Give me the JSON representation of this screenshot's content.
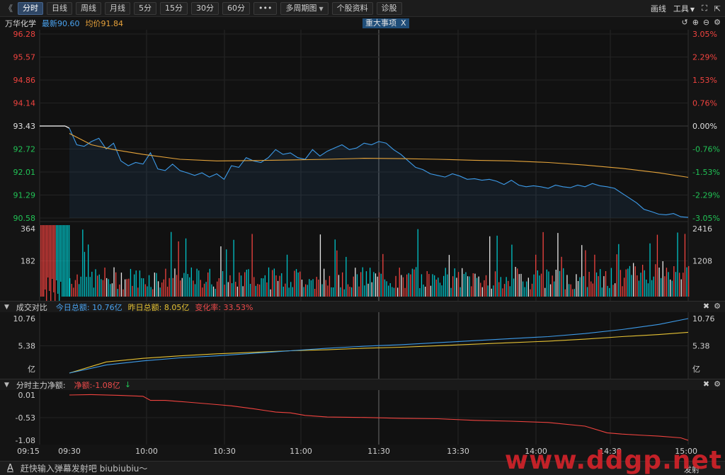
{
  "toolbar": {
    "back": "《",
    "buttons": [
      {
        "label": "分时",
        "active": true
      },
      {
        "label": "日线",
        "active": false
      },
      {
        "label": "周线",
        "active": false
      },
      {
        "label": "月线",
        "active": false
      },
      {
        "label": "5分",
        "active": false
      },
      {
        "label": "15分",
        "active": false
      },
      {
        "label": "30分",
        "active": false
      },
      {
        "label": "60分",
        "active": false
      },
      {
        "label": "•••",
        "active": false
      },
      {
        "label": "多周期图",
        "active": false,
        "dropdown": true
      },
      {
        "label": "个股资料",
        "active": false
      },
      {
        "label": "诊股",
        "active": false
      }
    ],
    "draw": "画线",
    "tools": "工具"
  },
  "info": {
    "name": "万华化学",
    "latest": "最新90.60",
    "avg": "均价91.84",
    "event": "重大事项",
    "event_close": "X"
  },
  "volume_header": {
    "title": "成交对比",
    "today": "今日总额: 10.76亿",
    "yesterday": "昨日总额: 8.05亿",
    "change": "变化率: 33.53%"
  },
  "flow_header": {
    "title": "分时主力净额:",
    "net": "净额:-1.08亿",
    "arrow": "↓"
  },
  "bottom": {
    "danmu_placeholder": "赶快输入弹幕发射吧 biubiubiu～",
    "send": "发射",
    "watermark": "www.ddgp.net"
  },
  "colors": {
    "price": "#3d9be9",
    "avg": "#e6a43a",
    "up": "#f0433f",
    "down": "#00c3c8",
    "neutral": "#e8e8e8",
    "today": "#3d9be9",
    "yesterday": "#e6c234",
    "flow": "#f0433f"
  },
  "chart_data": {
    "type": "line",
    "x_ticks": [
      "09:15",
      "09:30",
      "10:00",
      "10:30",
      "11:00",
      "11:30",
      "13:30",
      "14:00",
      "14:30",
      "15:00"
    ],
    "price_panel": {
      "prev_close": 93.43,
      "ylim": [
        90.58,
        96.28
      ],
      "y_ticks": [
        "96.28",
        "95.57",
        "94.86",
        "94.14",
        "93.43",
        "92.72",
        "92.01",
        "91.29",
        "90.58"
      ],
      "pct_ticks": [
        "3.05%",
        "2.29%",
        "1.53%",
        "0.76%",
        "0.00%",
        "-0.76%",
        "-1.53%",
        "-2.29%",
        "-3.05%"
      ],
      "pre_market_level": 93.43,
      "series": [
        {
          "name": "最新",
          "points": [
            [
              0,
              93.36
            ],
            [
              2,
              92.85
            ],
            [
              4,
              92.8
            ],
            [
              6,
              92.95
            ],
            [
              8,
              93.05
            ],
            [
              10,
              92.72
            ],
            [
              12,
              92.9
            ],
            [
              14,
              92.35
            ],
            [
              16,
              92.2
            ],
            [
              18,
              92.3
            ],
            [
              20,
              92.25
            ],
            [
              22,
              92.6
            ],
            [
              24,
              92.1
            ],
            [
              26,
              92.05
            ],
            [
              28,
              92.25
            ],
            [
              30,
              92.05
            ],
            [
              32,
              91.98
            ],
            [
              34,
              91.9
            ],
            [
              36,
              91.98
            ],
            [
              38,
              91.85
            ],
            [
              40,
              91.95
            ],
            [
              42,
              91.78
            ],
            [
              44,
              92.2
            ],
            [
              46,
              92.15
            ],
            [
              48,
              92.45
            ],
            [
              50,
              92.35
            ],
            [
              52,
              92.3
            ],
            [
              54,
              92.45
            ],
            [
              56,
              92.7
            ],
            [
              58,
              92.55
            ],
            [
              60,
              92.6
            ],
            [
              62,
              92.45
            ],
            [
              64,
              92.4
            ],
            [
              66,
              92.7
            ],
            [
              68,
              92.5
            ],
            [
              70,
              92.65
            ],
            [
              72,
              92.75
            ],
            [
              74,
              92.85
            ],
            [
              76,
              92.7
            ],
            [
              78,
              92.75
            ],
            [
              80,
              92.9
            ],
            [
              82,
              92.85
            ],
            [
              84,
              92.95
            ],
            [
              86,
              92.9
            ],
            [
              88,
              92.7
            ],
            [
              90,
              92.55
            ],
            [
              92,
              92.35
            ],
            [
              94,
              92.15
            ],
            [
              96,
              92.08
            ],
            [
              98,
              91.95
            ],
            [
              100,
              91.9
            ],
            [
              102,
              91.85
            ],
            [
              104,
              91.95
            ],
            [
              106,
              91.88
            ],
            [
              108,
              91.78
            ],
            [
              110,
              91.8
            ],
            [
              112,
              91.75
            ],
            [
              114,
              91.78
            ],
            [
              116,
              91.72
            ],
            [
              118,
              91.62
            ],
            [
              120,
              91.75
            ],
            [
              122,
              91.6
            ],
            [
              124,
              91.55
            ],
            [
              126,
              91.58
            ],
            [
              128,
              91.55
            ],
            [
              130,
              91.5
            ],
            [
              132,
              91.6
            ],
            [
              134,
              91.55
            ],
            [
              136,
              91.52
            ],
            [
              138,
              91.6
            ],
            [
              140,
              91.55
            ],
            [
              142,
              91.65
            ],
            [
              144,
              91.58
            ],
            [
              146,
              91.55
            ],
            [
              148,
              91.5
            ],
            [
              150,
              91.35
            ],
            [
              152,
              91.2
            ],
            [
              154,
              91.05
            ],
            [
              156,
              90.85
            ],
            [
              158,
              90.78
            ],
            [
              160,
              90.7
            ],
            [
              162,
              90.68
            ],
            [
              164,
              90.72
            ],
            [
              166,
              90.62
            ],
            [
              168,
              90.6
            ]
          ]
        },
        {
          "name": "均价",
          "points": [
            [
              0,
              93.2
            ],
            [
              6,
              92.85
            ],
            [
              12,
              92.7
            ],
            [
              20,
              92.55
            ],
            [
              30,
              92.4
            ],
            [
              40,
              92.35
            ],
            [
              50,
              92.36
            ],
            [
              60,
              92.38
            ],
            [
              70,
              92.4
            ],
            [
              80,
              92.43
            ],
            [
              90,
              92.42
            ],
            [
              100,
              92.4
            ],
            [
              110,
              92.37
            ],
            [
              120,
              92.35
            ],
            [
              130,
              92.3
            ],
            [
              140,
              92.22
            ],
            [
              150,
              92.12
            ],
            [
              160,
              91.98
            ],
            [
              168,
              91.84
            ]
          ]
        }
      ]
    },
    "volume_panel": {
      "left_ticks": [
        "364",
        "182"
      ],
      "right_ticks": [
        "2416",
        "1208"
      ],
      "ymax": 364
    },
    "amount_panel": {
      "ylim": [
        0,
        10.76
      ],
      "y_ticks": [
        "10.76",
        "5.38",
        "亿"
      ],
      "series": [
        {
          "name": "今日总额",
          "points": [
            [
              0,
              0
            ],
            [
              10,
              1.6
            ],
            [
              20,
              2.4
            ],
            [
              30,
              3.0
            ],
            [
              40,
              3.4
            ],
            [
              50,
              3.9
            ],
            [
              60,
              4.4
            ],
            [
              70,
              4.9
            ],
            [
              80,
              5.3
            ],
            [
              90,
              5.6
            ],
            [
              100,
              6.0
            ],
            [
              110,
              6.4
            ],
            [
              120,
              6.8
            ],
            [
              130,
              7.2
            ],
            [
              140,
              7.8
            ],
            [
              150,
              8.6
            ],
            [
              160,
              9.6
            ],
            [
              168,
              10.76
            ]
          ]
        },
        {
          "name": "昨日总额",
          "points": [
            [
              0,
              0
            ],
            [
              10,
              2.2
            ],
            [
              20,
              2.9
            ],
            [
              30,
              3.4
            ],
            [
              40,
              3.8
            ],
            [
              50,
              4.1
            ],
            [
              60,
              4.4
            ],
            [
              70,
              4.6
            ],
            [
              80,
              4.9
            ],
            [
              90,
              5.1
            ],
            [
              100,
              5.4
            ],
            [
              110,
              5.7
            ],
            [
              120,
              6.0
            ],
            [
              130,
              6.3
            ],
            [
              140,
              6.7
            ],
            [
              150,
              7.2
            ],
            [
              160,
              7.6
            ],
            [
              168,
              8.05
            ]
          ]
        }
      ]
    },
    "flow_panel": {
      "ylim": [
        -1.08,
        0.01
      ],
      "y_ticks": [
        "0.01",
        "-0.53",
        "-1.08"
      ],
      "series": [
        {
          "name": "净额",
          "points": [
            [
              0,
              0.01
            ],
            [
              6,
              0.02
            ],
            [
              14,
              0.0
            ],
            [
              20,
              -0.02
            ],
            [
              22,
              -0.12
            ],
            [
              26,
              -0.12
            ],
            [
              32,
              -0.16
            ],
            [
              40,
              -0.22
            ],
            [
              44,
              -0.25
            ],
            [
              50,
              -0.32
            ],
            [
              56,
              -0.4
            ],
            [
              60,
              -0.42
            ],
            [
              64,
              -0.48
            ],
            [
              70,
              -0.52
            ],
            [
              80,
              -0.53
            ],
            [
              90,
              -0.55
            ],
            [
              100,
              -0.56
            ],
            [
              110,
              -0.6
            ],
            [
              120,
              -0.62
            ],
            [
              130,
              -0.65
            ],
            [
              140,
              -0.74
            ],
            [
              146,
              -0.9
            ],
            [
              150,
              -0.93
            ],
            [
              156,
              -0.96
            ],
            [
              160,
              -0.98
            ],
            [
              166,
              -1.02
            ],
            [
              168,
              -1.08
            ]
          ]
        }
      ]
    }
  }
}
